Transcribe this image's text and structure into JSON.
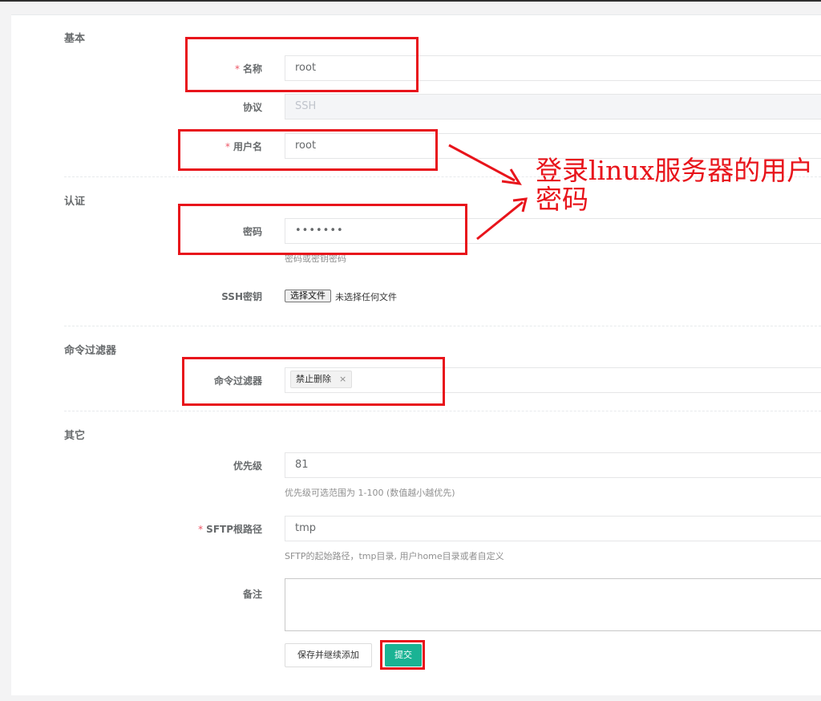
{
  "sections": {
    "basic": "基本",
    "auth": "认证",
    "filter": "命令过滤器",
    "other": "其它"
  },
  "fields": {
    "name": {
      "required_mark": "*",
      "label": "名称",
      "value": "root"
    },
    "protocol": {
      "label": "协议",
      "value": "SSH"
    },
    "username": {
      "required_mark": "*",
      "label": "用户名",
      "value": "root"
    },
    "password": {
      "label": "密码",
      "value": "•••••••",
      "help": "密码或密钥密码"
    },
    "ssh_key": {
      "label": "SSH密钥",
      "button": "选择文件",
      "status": "未选择任何文件"
    },
    "cmd_filter": {
      "label": "命令过滤器",
      "tag": "禁止删除",
      "tag_remove": "×"
    },
    "priority": {
      "label": "优先级",
      "value": "81",
      "help": "优先级可选范围为 1-100 (数值越小越优先)"
    },
    "sftp_root": {
      "required_mark": "*",
      "label": "SFTP根路径",
      "value": "tmp",
      "help": "SFTP的起始路径，tmp目录, 用户home目录或者自定义"
    },
    "comment": {
      "label": "备注",
      "value": ""
    }
  },
  "buttons": {
    "save_continue": "保存并继续添加",
    "submit": "提交"
  },
  "annotation": {
    "text": "登录linux服务器的用户密码",
    "color": "#e8141b"
  },
  "colors": {
    "accent": "#1ab394",
    "required": "#ed5565",
    "highlight": "#e8141b"
  }
}
